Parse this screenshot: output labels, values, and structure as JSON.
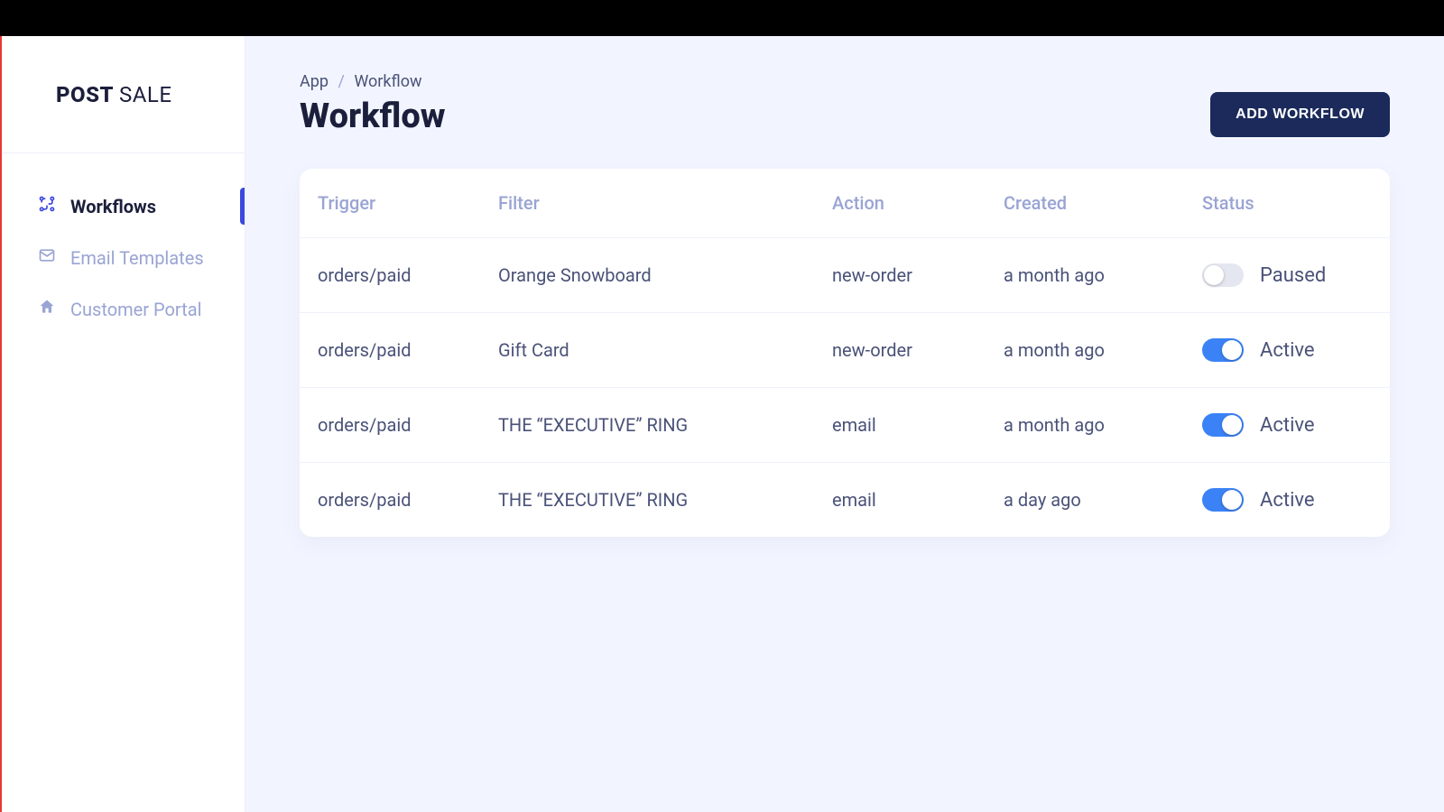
{
  "brand": {
    "bold": "POST",
    "light": "SALE"
  },
  "sidebar": {
    "items": [
      {
        "label": "Workflows",
        "active": true
      },
      {
        "label": "Email Templates",
        "active": false
      },
      {
        "label": "Customer Portal",
        "active": false
      }
    ]
  },
  "breadcrumb": {
    "root": "App",
    "current": "Workflow"
  },
  "page_title": "Workflow",
  "add_button": "ADD WORKFLOW",
  "table": {
    "headers": {
      "trigger": "Trigger",
      "filter": "Filter",
      "action": "Action",
      "created": "Created",
      "status": "Status"
    },
    "rows": [
      {
        "trigger": "orders/paid",
        "filter": "Orange Snowboard",
        "action": "new-order",
        "created": "a month ago",
        "status_label": "Paused",
        "active": false
      },
      {
        "trigger": "orders/paid",
        "filter": "Gift Card",
        "action": "new-order",
        "created": "a month ago",
        "status_label": "Active",
        "active": true
      },
      {
        "trigger": "orders/paid",
        "filter": "THE “EXECUTIVE” RING",
        "action": "email",
        "created": "a month ago",
        "status_label": "Active",
        "active": true
      },
      {
        "trigger": "orders/paid",
        "filter": "THE “EXECUTIVE” RING",
        "action": "email",
        "created": "a day ago",
        "status_label": "Active",
        "active": true
      }
    ]
  }
}
